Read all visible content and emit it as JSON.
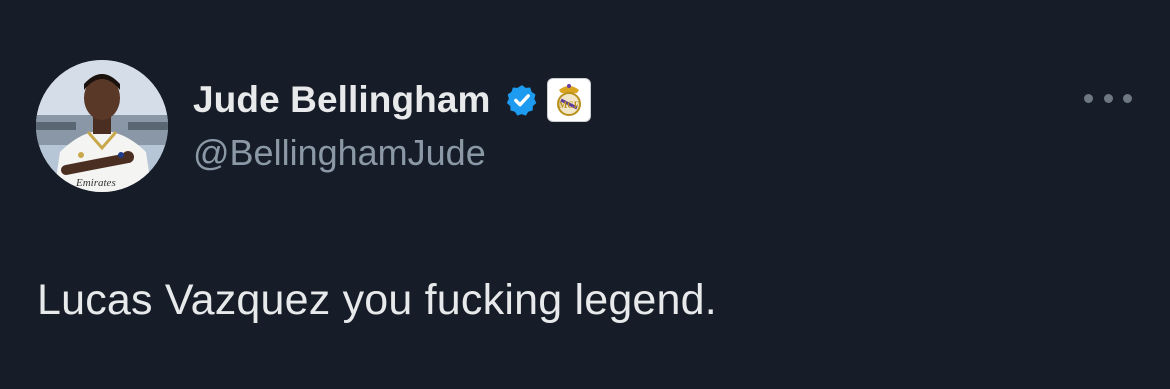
{
  "tweet": {
    "author": {
      "display_name": "Jude Bellingham",
      "handle": "@BellinghamJude",
      "verified": true,
      "verified_badge_color": "#1d9bf0",
      "affiliate_badge": "real-madrid-crest-icon",
      "avatar_jersey_text": "Emirates"
    },
    "text": "Lucas Vazquez you fucking legend.",
    "more_icon": "more-options-icon"
  },
  "theme": {
    "background": "#161d28",
    "text_primary": "#e7e9ea",
    "text_secondary": "#8b98a5"
  }
}
